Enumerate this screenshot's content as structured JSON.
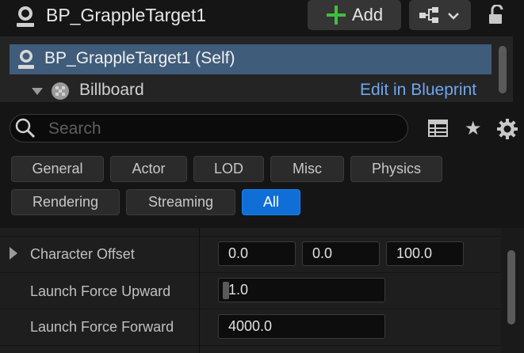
{
  "header": {
    "title": "BP_GrappleTarget1",
    "add_label": "Add"
  },
  "tree": {
    "self_label": "BP_GrappleTarget1 (Self)",
    "child_label": "Billboard",
    "edit_link": "Edit in Blueprint"
  },
  "search": {
    "placeholder": "Search"
  },
  "filters": {
    "general": "General",
    "actor": "Actor",
    "lod": "LOD",
    "misc": "Misc",
    "physics": "Physics",
    "rendering": "Rendering",
    "streaming": "Streaming",
    "all": "All"
  },
  "properties": {
    "character_offset": {
      "label": "Character Offset",
      "x": "0.0",
      "y": "0.0",
      "z": "100.0"
    },
    "launch_force_upward": {
      "label": "Launch Force Upward",
      "value": "1.0"
    },
    "launch_force_forward": {
      "label": "Launch Force Forward",
      "value": "4000.0"
    }
  },
  "colors": {
    "accent": "#0f6fd6",
    "selection": "#3f5c7a",
    "link": "#6fa7ee",
    "add_plus": "#3fbf3f"
  },
  "icons": [
    "actor-icon",
    "plus-icon",
    "blueprint-icon",
    "chevron-down-icon",
    "lock-icon",
    "billboard-icon",
    "search-icon",
    "table-icon",
    "star-icon",
    "gear-icon"
  ]
}
